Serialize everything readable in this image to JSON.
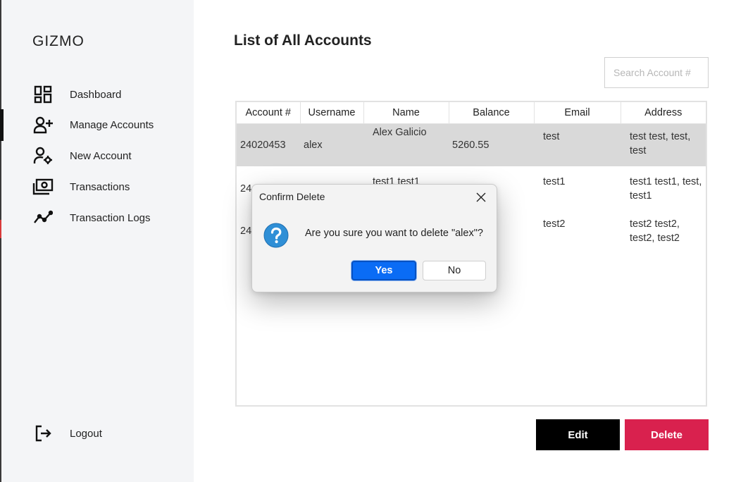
{
  "app": {
    "brand": "GIZMO"
  },
  "sidebar": {
    "items": [
      {
        "label": "Dashboard",
        "icon": "dashboard-icon"
      },
      {
        "label": "Manage Accounts",
        "icon": "add-user-icon"
      },
      {
        "label": "New Account",
        "icon": "user-settings-icon"
      },
      {
        "label": "Transactions",
        "icon": "money-icon"
      },
      {
        "label": "Transaction Logs",
        "icon": "trend-line-icon"
      }
    ],
    "logout": {
      "label": "Logout",
      "icon": "logout-icon"
    }
  },
  "main": {
    "title": "List of All Accounts",
    "search": {
      "placeholder": "Search Account #",
      "value": ""
    },
    "table": {
      "columns": [
        "Account #",
        "Username",
        "Name",
        "Balance",
        "Email",
        "Address"
      ],
      "rows": [
        {
          "account": "24020453",
          "username": "alex",
          "name": "Alex Galicio",
          "balance": "5260.55",
          "email": "test",
          "address": "test test, test, test"
        },
        {
          "account": "24",
          "username": "",
          "name": "test1 test1",
          "balance": "",
          "email": "test1",
          "address": "test1 test1, test, test1"
        },
        {
          "account": "24",
          "username": "",
          "name": "",
          "balance": "",
          "email": "test2",
          "address": "test2 test2, test2, test2"
        }
      ]
    },
    "actions": {
      "edit": "Edit",
      "delete": "Delete"
    }
  },
  "dialog": {
    "title": "Confirm Delete",
    "message": "Are you sure you want to delete \"alex\"?",
    "yes": "Yes",
    "no": "No",
    "icon": "question-icon"
  },
  "colors": {
    "sidebar_bg": "#f4f5f7",
    "selected_row": "#d9d9d9",
    "edit_button": "#000000",
    "delete_button": "#d9214e",
    "dialog_primary": "#0a6cf5",
    "question_icon": "#2f8fd6"
  }
}
